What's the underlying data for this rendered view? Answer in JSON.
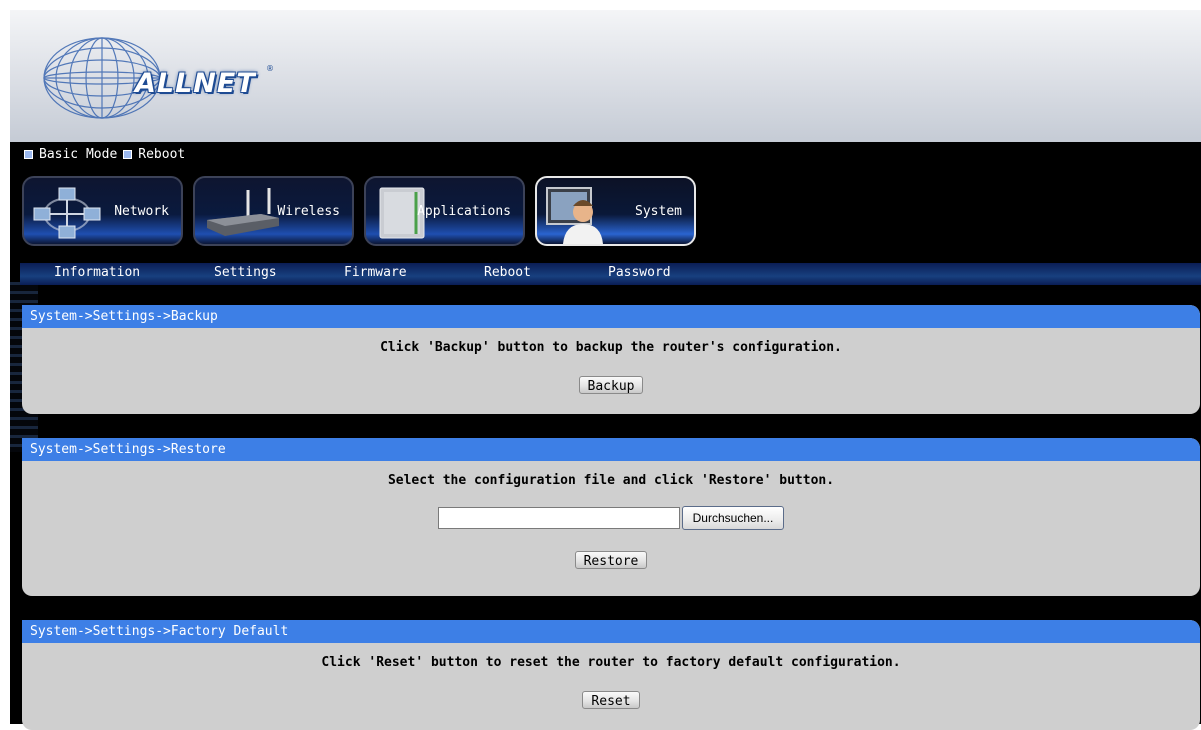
{
  "brand": {
    "logo_text": "ALLNET",
    "registered_mark": "®"
  },
  "topnav": {
    "items": [
      "Basic Mode",
      "Reboot"
    ]
  },
  "tabs": [
    {
      "label": "Network",
      "icon": "network-icon",
      "active": false
    },
    {
      "label": "Wireless",
      "icon": "router-icon",
      "active": false
    },
    {
      "label": "Applications",
      "icon": "applications-icon",
      "active": false
    },
    {
      "label": "System",
      "icon": "system-user-icon",
      "active": true
    }
  ],
  "subnav": [
    "Information",
    "Settings",
    "Firmware",
    "Reboot",
    "Password"
  ],
  "panels": {
    "backup": {
      "title": "System->Settings->Backup",
      "message": "Click 'Backup' button to backup the router's configuration.",
      "button": "Backup"
    },
    "restore": {
      "title": "System->Settings->Restore",
      "message": "Select the configuration file and click 'Restore' button.",
      "file_value": "",
      "browse_label": "Durchsuchen...",
      "button": "Restore"
    },
    "factory": {
      "title": "System->Settings->Factory Default",
      "message": "Click 'Reset' button to reset the router to factory default configuration.",
      "button": "Reset"
    }
  },
  "colors": {
    "panel_header": "#3d7fe6",
    "panel_body": "#cfcfcf",
    "background": "#000000",
    "header_bg": "#dfe2e8",
    "logo_blue": "#1e4b93"
  }
}
